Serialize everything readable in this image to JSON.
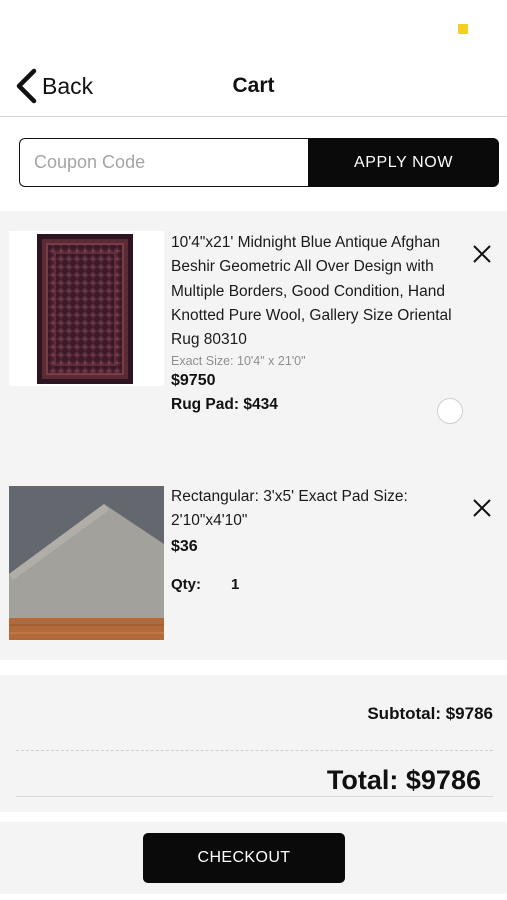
{
  "header": {
    "back_label": "Back",
    "title": "Cart",
    "status_color": "#f5cf1f"
  },
  "coupon": {
    "placeholder": "Coupon Code",
    "value": "",
    "apply_label": "APPLY NOW"
  },
  "items": [
    {
      "title": "10'4\"x21' Midnight Blue Antique Afghan Beshir Geometric All Over Design with Multiple Borders, Good Condition, Hand Knotted Pure Wool, Gallery Size Oriental Rug 80310",
      "exact_size": "Exact Size: 10'4\" x 21'0\"",
      "price": "$9750",
      "rug_pad": "Rug Pad: $434",
      "image": "rug-thumbnail",
      "remove_icon": "close-icon",
      "rug_pad_selected": false
    },
    {
      "title": "Rectangular: 3'x5' Exact Pad Size: 2'10\"x4'10\"",
      "price": "$36",
      "qty_label": "Qty:",
      "qty": "1",
      "image": "rug-pad-thumbnail",
      "remove_icon": "close-icon"
    }
  ],
  "totals": {
    "subtotal": "Subtotal: $9786",
    "total": "Total: $9786"
  },
  "checkout": {
    "label": "CHECKOUT"
  },
  "colors": {
    "background": "#ffffff",
    "panel": "#f4f4f4",
    "button": "#0a0a0a",
    "button_text": "#ffffff"
  }
}
